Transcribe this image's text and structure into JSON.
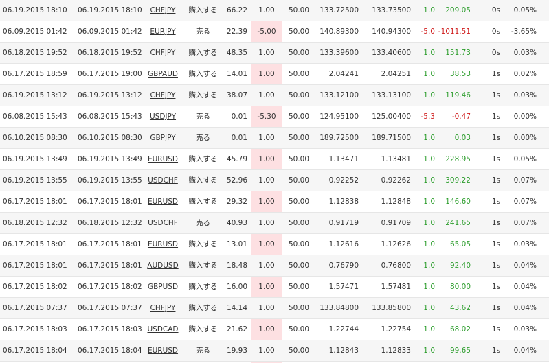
{
  "colors": {
    "positive": "#2e9e2e",
    "negative": "#d02020",
    "highlight_column": "#fde0e2"
  },
  "rows": [
    {
      "open": "06.19.2015 18:10",
      "close": "06.19.2015 18:10",
      "symbol": "CHFJPY",
      "side": "購入する",
      "vol": "66.22",
      "lots": "1.00",
      "amount": "50.00",
      "open_price": "133.72500",
      "close_price": "133.73500",
      "pips": "1.0",
      "profit": "209.05",
      "duration": "0s",
      "pct": "0.05%",
      "sign": "pos"
    },
    {
      "open": "06.09.2015 01:42",
      "close": "06.09.2015 01:42",
      "symbol": "EURJPY",
      "side": "売る",
      "vol": "22.39",
      "lots": "-5.00",
      "amount": "50.00",
      "open_price": "140.89300",
      "close_price": "140.94300",
      "pips": "-5.0",
      "profit": "-1011.51",
      "duration": "0s",
      "pct": "-3.65%",
      "sign": "neg"
    },
    {
      "open": "06.18.2015 19:52",
      "close": "06.18.2015 19:52",
      "symbol": "CHFJPY",
      "side": "購入する",
      "vol": "48.35",
      "lots": "1.00",
      "amount": "50.00",
      "open_price": "133.39600",
      "close_price": "133.40600",
      "pips": "1.0",
      "profit": "151.73",
      "duration": "0s",
      "pct": "0.03%",
      "sign": "pos"
    },
    {
      "open": "06.17.2015 18:59",
      "close": "06.17.2015 19:00",
      "symbol": "GBPAUD",
      "side": "購入する",
      "vol": "14.01",
      "lots": "1.00",
      "amount": "50.00",
      "open_price": "2.04241",
      "close_price": "2.04251",
      "pips": "1.0",
      "profit": "38.53",
      "duration": "1s",
      "pct": "0.02%",
      "sign": "pos"
    },
    {
      "open": "06.19.2015 13:12",
      "close": "06.19.2015 13:12",
      "symbol": "CHFJPY",
      "side": "購入する",
      "vol": "38.07",
      "lots": "1.00",
      "amount": "50.00",
      "open_price": "133.12100",
      "close_price": "133.13100",
      "pips": "1.0",
      "profit": "119.46",
      "duration": "1s",
      "pct": "0.03%",
      "sign": "pos"
    },
    {
      "open": "06.08.2015 15:43",
      "close": "06.08.2015 15:43",
      "symbol": "USDJPY",
      "side": "売る",
      "vol": "0.01",
      "lots": "-5.30",
      "amount": "50.00",
      "open_price": "124.95100",
      "close_price": "125.00400",
      "pips": "-5.3",
      "profit": "-0.47",
      "duration": "1s",
      "pct": "0.00%",
      "sign": "neg"
    },
    {
      "open": "06.10.2015 08:30",
      "close": "06.10.2015 08:30",
      "symbol": "GBPJPY",
      "side": "売る",
      "vol": "0.01",
      "lots": "1.00",
      "amount": "50.00",
      "open_price": "189.72500",
      "close_price": "189.71500",
      "pips": "1.0",
      "profit": "0.03",
      "duration": "1s",
      "pct": "0.00%",
      "sign": "pos"
    },
    {
      "open": "06.19.2015 13:49",
      "close": "06.19.2015 13:49",
      "symbol": "EURUSD",
      "side": "購入する",
      "vol": "45.79",
      "lots": "1.00",
      "amount": "50.00",
      "open_price": "1.13471",
      "close_price": "1.13481",
      "pips": "1.0",
      "profit": "228.95",
      "duration": "1s",
      "pct": "0.05%",
      "sign": "pos"
    },
    {
      "open": "06.19.2015 13:55",
      "close": "06.19.2015 13:55",
      "symbol": "USDCHF",
      "side": "購入する",
      "vol": "52.96",
      "lots": "1.00",
      "amount": "50.00",
      "open_price": "0.92252",
      "close_price": "0.92262",
      "pips": "1.0",
      "profit": "309.22",
      "duration": "1s",
      "pct": "0.07%",
      "sign": "pos"
    },
    {
      "open": "06.17.2015 18:01",
      "close": "06.17.2015 18:01",
      "symbol": "EURUSD",
      "side": "購入する",
      "vol": "29.32",
      "lots": "1.00",
      "amount": "50.00",
      "open_price": "1.12838",
      "close_price": "1.12848",
      "pips": "1.0",
      "profit": "146.60",
      "duration": "1s",
      "pct": "0.07%",
      "sign": "pos"
    },
    {
      "open": "06.18.2015 12:32",
      "close": "06.18.2015 12:32",
      "symbol": "USDCHF",
      "side": "売る",
      "vol": "40.93",
      "lots": "1.00",
      "amount": "50.00",
      "open_price": "0.91719",
      "close_price": "0.91709",
      "pips": "1.0",
      "profit": "241.65",
      "duration": "1s",
      "pct": "0.07%",
      "sign": "pos"
    },
    {
      "open": "06.17.2015 18:01",
      "close": "06.17.2015 18:01",
      "symbol": "EURUSD",
      "side": "購入する",
      "vol": "13.01",
      "lots": "1.00",
      "amount": "50.00",
      "open_price": "1.12616",
      "close_price": "1.12626",
      "pips": "1.0",
      "profit": "65.05",
      "duration": "1s",
      "pct": "0.03%",
      "sign": "pos"
    },
    {
      "open": "06.17.2015 18:01",
      "close": "06.17.2015 18:01",
      "symbol": "AUDUSD",
      "side": "購入する",
      "vol": "18.48",
      "lots": "1.00",
      "amount": "50.00",
      "open_price": "0.76790",
      "close_price": "0.76800",
      "pips": "1.0",
      "profit": "92.40",
      "duration": "1s",
      "pct": "0.04%",
      "sign": "pos"
    },
    {
      "open": "06.17.2015 18:02",
      "close": "06.17.2015 18:02",
      "symbol": "GBPUSD",
      "side": "購入する",
      "vol": "16.00",
      "lots": "1.00",
      "amount": "50.00",
      "open_price": "1.57471",
      "close_price": "1.57481",
      "pips": "1.0",
      "profit": "80.00",
      "duration": "1s",
      "pct": "0.04%",
      "sign": "pos"
    },
    {
      "open": "06.17.2015 07:37",
      "close": "06.17.2015 07:37",
      "symbol": "CHFJPY",
      "side": "購入する",
      "vol": "14.14",
      "lots": "1.00",
      "amount": "50.00",
      "open_price": "133.84800",
      "close_price": "133.85800",
      "pips": "1.0",
      "profit": "43.62",
      "duration": "1s",
      "pct": "0.04%",
      "sign": "pos"
    },
    {
      "open": "06.17.2015 18:03",
      "close": "06.17.2015 18:03",
      "symbol": "USDCAD",
      "side": "購入する",
      "vol": "21.62",
      "lots": "1.00",
      "amount": "50.00",
      "open_price": "1.22744",
      "close_price": "1.22754",
      "pips": "1.0",
      "profit": "68.02",
      "duration": "1s",
      "pct": "0.03%",
      "sign": "pos"
    },
    {
      "open": "06.17.2015 18:04",
      "close": "06.17.2015 18:04",
      "symbol": "EURUSD",
      "side": "売る",
      "vol": "19.93",
      "lots": "1.00",
      "amount": "50.00",
      "open_price": "1.12843",
      "close_price": "1.12833",
      "pips": "1.0",
      "profit": "99.65",
      "duration": "1s",
      "pct": "0.04%",
      "sign": "pos"
    }
  ]
}
